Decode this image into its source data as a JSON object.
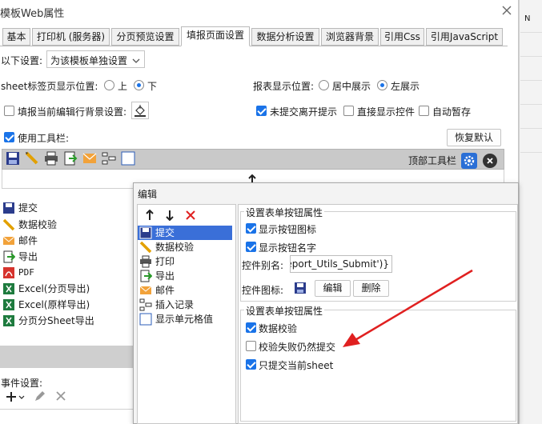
{
  "window": {
    "title": "模板Web属性"
  },
  "right_edge": {
    "letter": "N"
  },
  "tabs": [
    {
      "label": "基本"
    },
    {
      "label": "打印机 (服务器)"
    },
    {
      "label": "分页预览设置"
    },
    {
      "label": "填报页面设置"
    },
    {
      "label": "数据分析设置"
    },
    {
      "label": "浏览器背景"
    },
    {
      "label": "引用Css"
    },
    {
      "label": "引用JavaScript"
    }
  ],
  "settings": {
    "scope_label": "以下设置:",
    "scope_value": "为该模板单独设置",
    "sheet_pos_label": "sheet标签页显示位置:",
    "sheet_pos_up": "上",
    "sheet_pos_down": "下",
    "report_pos_label": "报表显示位置:",
    "report_pos_center": "居中展示",
    "report_pos_left": "左展示",
    "fill_bg_label": "填报当前编辑行背景设置:",
    "unsubmitted_label": "未提交离开提示",
    "direct_display_label": "直接显示控件",
    "auto_pause_label": "自动暂存",
    "use_toolbar_label": "使用工具栏:",
    "restore_default": "恢复默认",
    "top_toolbar_label": "顶部工具栏"
  },
  "left_list": [
    {
      "label": "提交",
      "icon": "save-icon"
    },
    {
      "label": "数据校验",
      "icon": "pencil-icon"
    },
    {
      "label": "邮件",
      "icon": "mail-icon"
    },
    {
      "label": "导出",
      "icon": "export-icon"
    },
    {
      "label": "PDF",
      "icon": "pdf-icon"
    },
    {
      "label": "Excel(分页导出)",
      "icon": "excel-icon"
    },
    {
      "label": "Excel(原样导出)",
      "icon": "excel-icon"
    },
    {
      "label": "分页分Sheet导出",
      "icon": "excel-icon"
    }
  ],
  "event_settings": {
    "label": "事件设置:"
  },
  "edit_dialog": {
    "title": "编辑",
    "list": [
      {
        "label": "提交",
        "icon": "save-icon"
      },
      {
        "label": "数据校验",
        "icon": "pencil-icon"
      },
      {
        "label": "打印",
        "icon": "printer-icon"
      },
      {
        "label": "导出",
        "icon": "export-icon"
      },
      {
        "label": "邮件",
        "icon": "mail-icon"
      },
      {
        "label": "插入记录",
        "icon": "insert-record-icon"
      },
      {
        "label": "显示单元格值",
        "icon": "cell-value-icon"
      }
    ],
    "section1_title": "设置表单按钮属性",
    "show_icon_label": "显示按钮图标",
    "show_name_label": "显示按钮名字",
    "alias_label": "控件别名:",
    "alias_value": "Report_Utils_Submit')}",
    "icon_label": "控件图标:",
    "edit_btn": "编辑",
    "delete_btn": "删除",
    "section2_title": "设置表单按钮属性",
    "data_verify_label": "数据校验",
    "verify_fail_label": "校验失败仍然提交",
    "only_current_sheet_label": "只提交当前sheet"
  },
  "colors": {
    "accent": "#1a73e8",
    "selection": "#3a6fd8",
    "arrow": "#e02020"
  }
}
